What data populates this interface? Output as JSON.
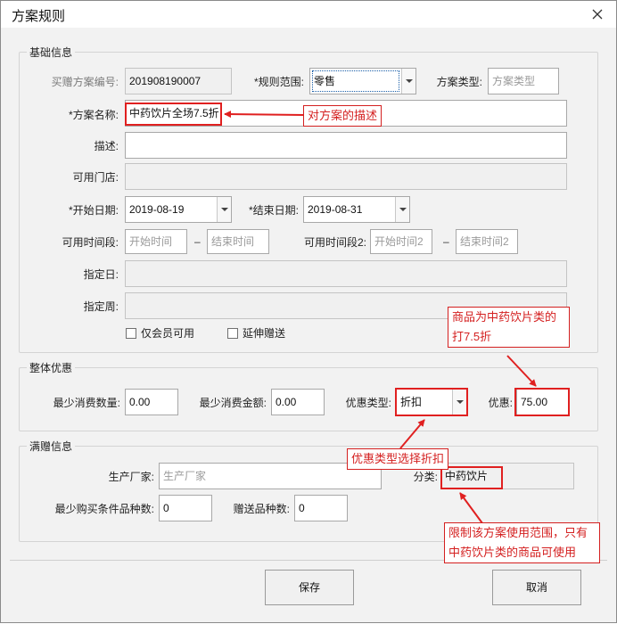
{
  "window": {
    "title": "方案规则"
  },
  "basic": {
    "legend": "基础信息",
    "buy_gift_no": {
      "label": "买赠方案编号:",
      "value": "201908190007"
    },
    "rule_scope": {
      "label": "*规则范围:",
      "value": "零售"
    },
    "plan_type": {
      "label": "方案类型:",
      "placeholder": "方案类型"
    },
    "plan_name": {
      "label": "*方案名称:",
      "value": "中药饮片全场7.5折"
    },
    "desc": {
      "label": "描述:",
      "value": ""
    },
    "stores": {
      "label": "可用门店:",
      "value": ""
    },
    "start_date": {
      "label": "*开始日期:",
      "value": "2019-08-19"
    },
    "end_date": {
      "label": "*结束日期:",
      "value": "2019-08-31"
    },
    "time1": {
      "label": "可用时间段:",
      "start_placeholder": "开始时间",
      "end_placeholder": "结束时间"
    },
    "time2": {
      "label": "可用时间段2:",
      "start_placeholder": "开始时间2",
      "end_placeholder": "结束时间2"
    },
    "dash": "–",
    "day": {
      "label": "指定日:"
    },
    "week": {
      "label": "指定周:"
    },
    "member_only": {
      "label": "仅会员可用",
      "checked": false
    },
    "extend_gift": {
      "label": "延伸赠送",
      "checked": false
    }
  },
  "overall": {
    "legend": "整体优惠",
    "min_qty": {
      "label": "最少消费数量:",
      "value": "0.00"
    },
    "min_amount": {
      "label": "最少消费金额:",
      "value": "0.00"
    },
    "discount_type": {
      "label": "优惠类型:",
      "value": "折扣"
    },
    "discount": {
      "label": "优惠:",
      "value": "75.00"
    }
  },
  "gift": {
    "legend": "满赠信息",
    "manufacturer": {
      "label": "生产厂家:",
      "placeholder": "生产厂家"
    },
    "category": {
      "label": "分类:",
      "value": "中药饮片"
    },
    "min_kinds": {
      "label": "最少购买条件品种数:",
      "value": "0"
    },
    "gift_kinds": {
      "label": "赠送品种数:",
      "value": "0"
    }
  },
  "annotations": {
    "name_note": "对方案的描述",
    "discount_note": [
      "商品为中药饮片类的",
      "打7.5折"
    ],
    "type_note": "优惠类型选择折扣",
    "category_note": [
      "限制该方案使用范围，只有",
      "中药饮片类的商品可使用"
    ],
    "color": "#e02020"
  },
  "buttons": {
    "save": "保存",
    "cancel": "取消"
  }
}
